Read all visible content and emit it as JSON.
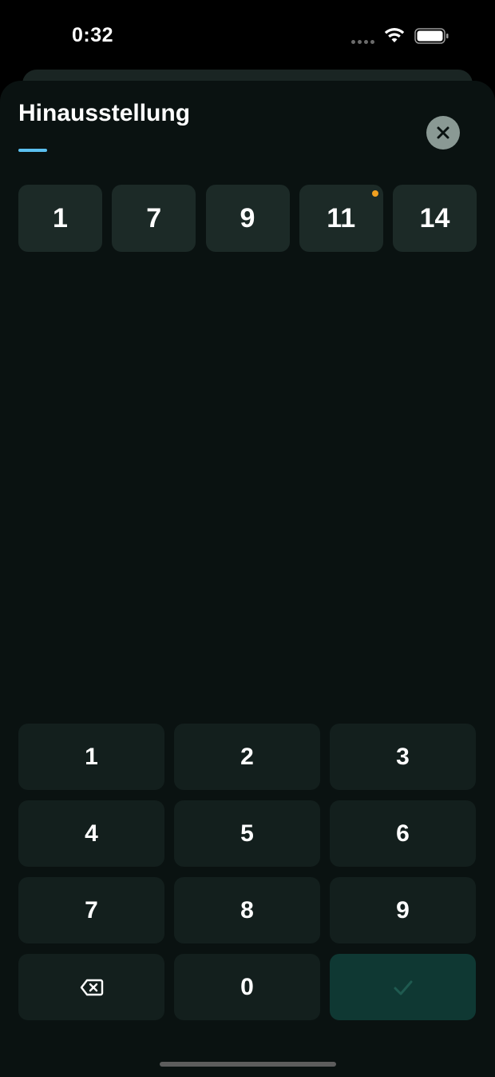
{
  "status_bar": {
    "time": "0:32",
    "signal_icon": "cellular-signal-icon",
    "wifi_icon": "wifi-icon",
    "battery_icon": "battery-icon"
  },
  "sheet": {
    "title": "Hinausstellung",
    "accent_color": "#5bc0f0",
    "close_icon": "close-icon"
  },
  "chips": [
    {
      "label": "1",
      "indicator": false
    },
    {
      "label": "7",
      "indicator": false
    },
    {
      "label": "9",
      "indicator": false
    },
    {
      "label": "11",
      "indicator": true,
      "indicator_color": "#f0a020"
    },
    {
      "label": "14",
      "indicator": false
    }
  ],
  "keypad": {
    "keys": [
      "1",
      "2",
      "3",
      "4",
      "5",
      "6",
      "7",
      "8",
      "9"
    ],
    "zero": "0",
    "backspace_icon": "backspace-icon",
    "confirm_icon": "checkmark-icon",
    "confirm_color": "#0f3833"
  }
}
